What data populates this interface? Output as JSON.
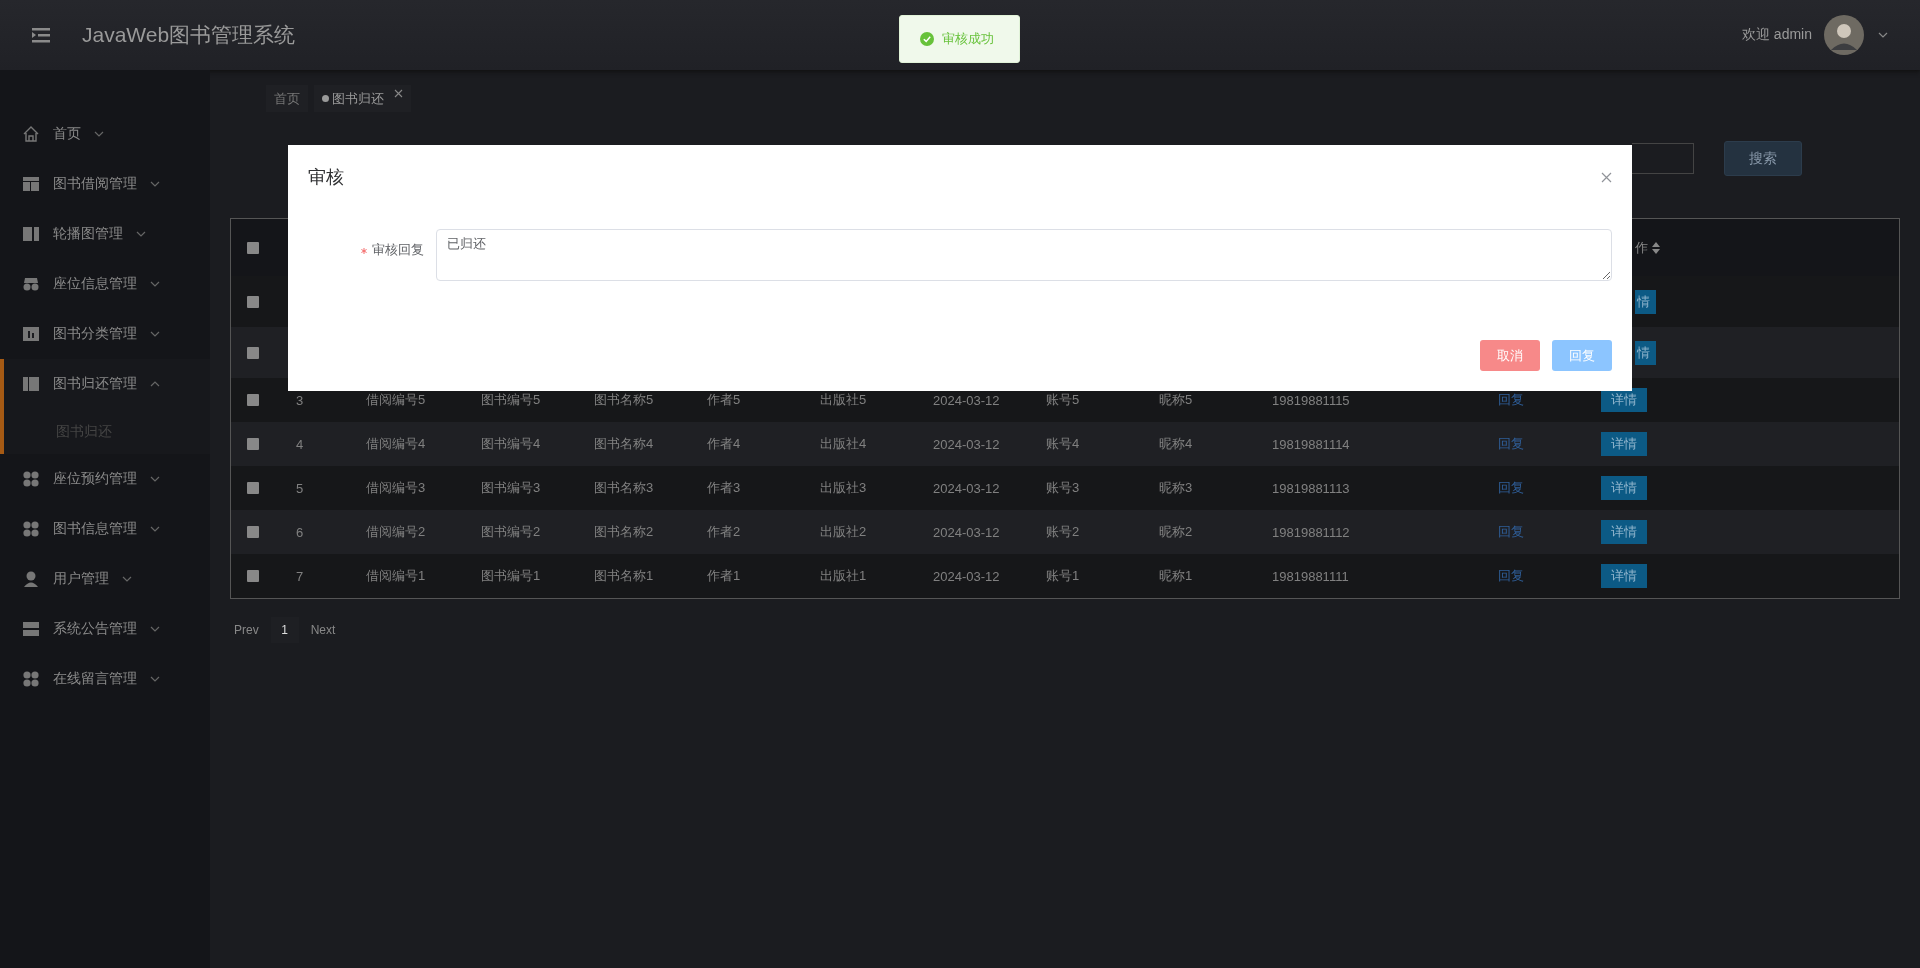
{
  "header": {
    "title": "JavaWeb图书管理系统",
    "welcome": "欢迎 admin"
  },
  "toast": {
    "kind": "success",
    "text": "审核成功"
  },
  "sidebar": {
    "items": [
      {
        "label": "首页",
        "expanded": false,
        "selected": false
      },
      {
        "label": "图书借阅管理",
        "expanded": false,
        "selected": false
      },
      {
        "label": "轮播图管理",
        "expanded": false,
        "selected": false
      },
      {
        "label": "座位信息管理",
        "expanded": false,
        "selected": false
      },
      {
        "label": "图书分类管理",
        "expanded": false,
        "selected": false
      },
      {
        "label": "图书归还管理",
        "expanded": true,
        "selected": true,
        "children": [
          {
            "label": "图书归还",
            "selected": true
          }
        ]
      },
      {
        "label": "座位预约管理",
        "expanded": false,
        "selected": false
      },
      {
        "label": "图书信息管理",
        "expanded": false,
        "selected": false
      },
      {
        "label": "用户管理",
        "expanded": false,
        "selected": false
      },
      {
        "label": "系统公告管理",
        "expanded": false,
        "selected": false
      },
      {
        "label": "在线留言管理",
        "expanded": false,
        "selected": false
      }
    ]
  },
  "breadcrumb": [
    {
      "label": "首页",
      "selected": false,
      "closable": false
    },
    {
      "label": "图书归还",
      "selected": true,
      "closable": true
    }
  ],
  "search": {
    "button": "搜索"
  },
  "table": {
    "all_checked": false,
    "columns": [
      {
        "label": "作",
        "sortable": true
      }
    ],
    "rows": [
      {
        "kind": "covered",
        "checked": false,
        "detail": "情"
      },
      {
        "kind": "covered",
        "checked": false,
        "detail": "情"
      },
      {
        "kind": "full",
        "checked": false,
        "index": "3",
        "cells": [
          "借阅编号5",
          "图书编号5",
          "图书名称5",
          "作者5",
          "出版社5",
          "2024-03-12",
          "账号5",
          "昵称5",
          "19819881115"
        ],
        "reply": "回复",
        "detail": "详情"
      },
      {
        "kind": "full",
        "checked": false,
        "index": "4",
        "cells": [
          "借阅编号4",
          "图书编号4",
          "图书名称4",
          "作者4",
          "出版社4",
          "2024-03-12",
          "账号4",
          "昵称4",
          "19819881114"
        ],
        "reply": "回复",
        "detail": "详情"
      },
      {
        "kind": "full",
        "checked": false,
        "index": "5",
        "cells": [
          "借阅编号3",
          "图书编号3",
          "图书名称3",
          "作者3",
          "出版社3",
          "2024-03-12",
          "账号3",
          "昵称3",
          "19819881113"
        ],
        "reply": "回复",
        "detail": "详情"
      },
      {
        "kind": "full",
        "checked": false,
        "index": "6",
        "cells": [
          "借阅编号2",
          "图书编号2",
          "图书名称2",
          "作者2",
          "出版社2",
          "2024-03-12",
          "账号2",
          "昵称2",
          "19819881112"
        ],
        "reply": "回复",
        "detail": "详情"
      },
      {
        "kind": "full",
        "checked": false,
        "index": "7",
        "cells": [
          "借阅编号1",
          "图书编号1",
          "图书名称1",
          "作者1",
          "出版社1",
          "2024-03-12",
          "账号1",
          "昵称1",
          "19819881111"
        ],
        "reply": "回复",
        "detail": "详情"
      }
    ]
  },
  "pagination": {
    "prev": "Prev",
    "pages": [
      {
        "label": "1",
        "selected": true
      }
    ],
    "next": "Next"
  },
  "dialog": {
    "title": "审核",
    "label": "审核回复",
    "required": true,
    "value": "已归还",
    "buttons": [
      {
        "label": "取消",
        "kind": "danger"
      },
      {
        "label": "回复",
        "kind": "primary"
      }
    ]
  }
}
